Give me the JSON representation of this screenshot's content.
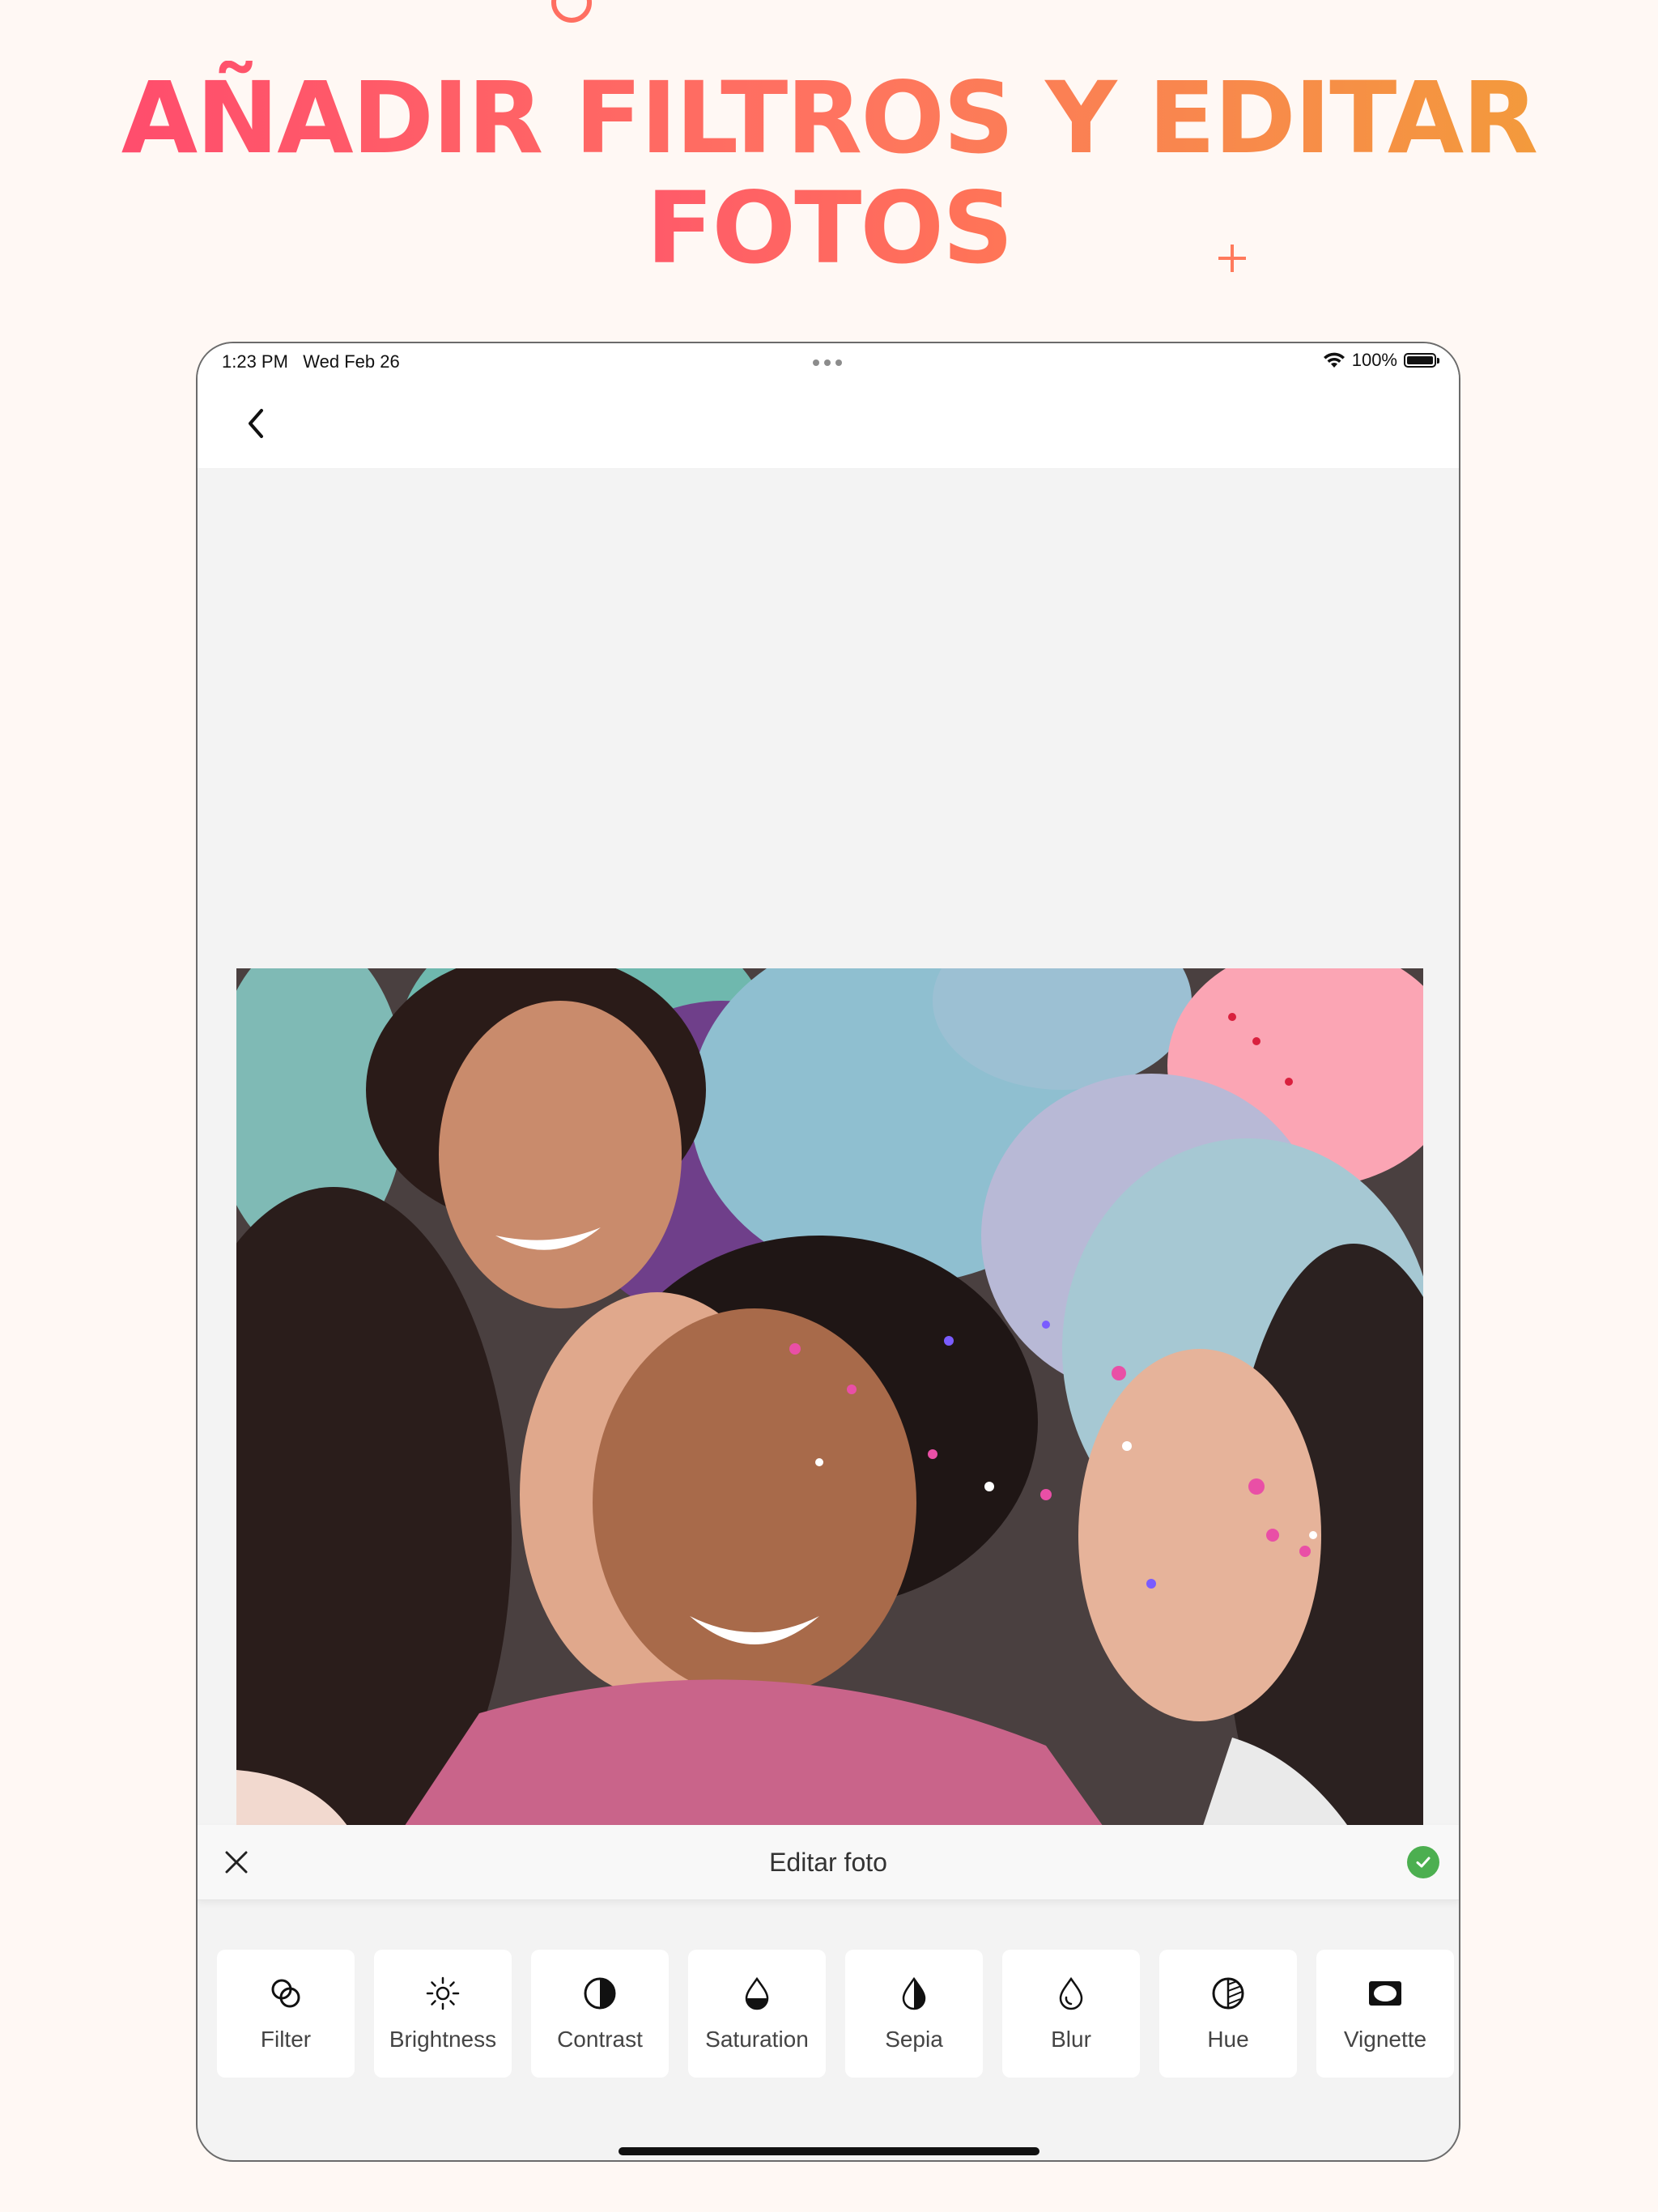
{
  "headline": {
    "line1": "AÑADIR FILTROS Y EDITAR",
    "line2": "FOTOS"
  },
  "status_bar": {
    "time": "1:23 PM",
    "date": "Wed Feb 26",
    "battery": "100%",
    "icons": [
      "wifi-icon",
      "battery-icon"
    ]
  },
  "nav": {
    "back_icon": "chevron-left-icon"
  },
  "photo": {
    "icon": "photo-party-friends"
  },
  "editor": {
    "title": "Editar foto",
    "close_icon": "close-icon",
    "confirm_icon": "check-circle-icon"
  },
  "tools": [
    {
      "label": "Filter",
      "icon": "filter-overlap-icon"
    },
    {
      "label": "Brightness",
      "icon": "sun-icon"
    },
    {
      "label": "Contrast",
      "icon": "contrast-icon"
    },
    {
      "label": "Saturation",
      "icon": "droplet-half-icon"
    },
    {
      "label": "Sepia",
      "icon": "droplet-split-icon"
    },
    {
      "label": "Blur",
      "icon": "droplet-outline-icon"
    },
    {
      "label": "Hue",
      "icon": "hue-icon"
    },
    {
      "label": "Vignette",
      "icon": "vignette-icon"
    }
  ],
  "colors": {
    "accent_pink": "#ff4d6d",
    "accent_orange": "#f39a3c",
    "confirm_green": "#4caf50",
    "background": "#fff8f4"
  }
}
